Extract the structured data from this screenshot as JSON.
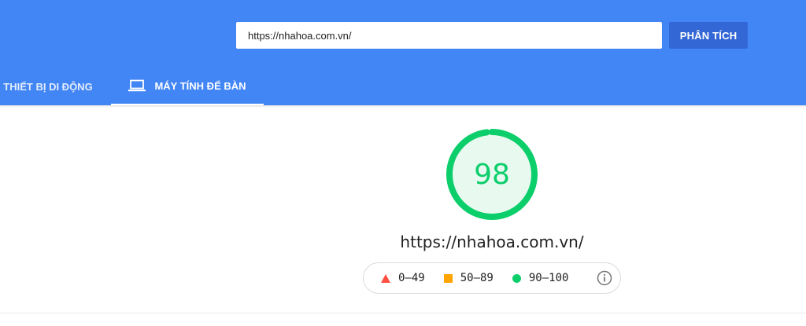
{
  "search": {
    "url_value": "https://nhahoa.com.vn/",
    "analyze_label": "PHÂN TÍCH"
  },
  "tabs": [
    {
      "label": "THIẾT BỊ DI ĐỘNG",
      "active": false
    },
    {
      "label": "MÁY TÍNH ĐỂ BÀN",
      "active": true,
      "icon": "desktop-icon"
    }
  ],
  "result": {
    "score": "98",
    "score_fraction": 0.98,
    "url": "https://nhahoa.com.vn/"
  },
  "legend": {
    "items": [
      {
        "label": "0–49",
        "marker": "triangle",
        "color": "#ff4e42"
      },
      {
        "label": "50–89",
        "marker": "square",
        "color": "#ffa400"
      },
      {
        "label": "90–100",
        "marker": "circle",
        "color": "#0cce6b"
      }
    ],
    "info_icon": "info-icon"
  },
  "colors": {
    "header_bg": "#4285f4",
    "button_bg": "#3367d6",
    "score_good": "#0cce6b",
    "gauge_fill": "#e8f9ef"
  }
}
